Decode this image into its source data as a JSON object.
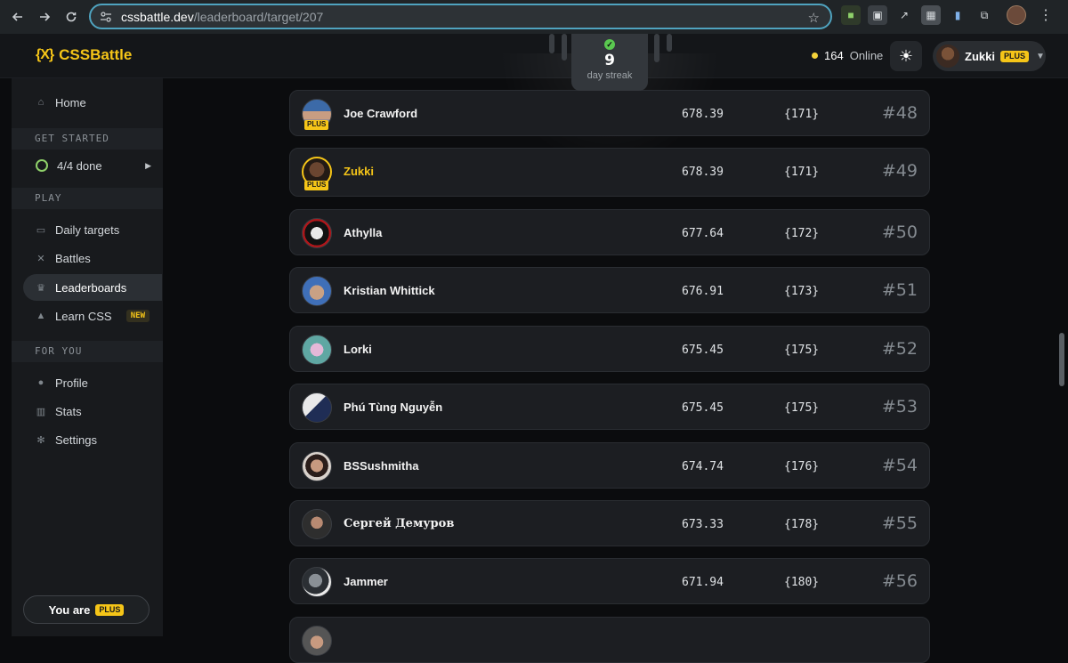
{
  "browser": {
    "url_domain": "cssbattle.dev",
    "url_path": "/leaderboard/target/207",
    "icons": [
      "back-icon",
      "forward-icon",
      "reload-icon",
      "site-info-icon",
      "bookmark-star-icon",
      "extensions-icon",
      "profile-avatar",
      "menu-icon"
    ]
  },
  "header": {
    "logo_mark": "{X}",
    "logo_text": "CSSBattle",
    "online_count": "164",
    "online_label": "Online",
    "user_name": "Zukki",
    "plus_label": "PLUS",
    "accent_color": "#f5c518"
  },
  "streak": {
    "count": "9",
    "label": "day streak"
  },
  "sidebar": {
    "home": "Home",
    "get_started_title": "GET STARTED",
    "progress": "4/4 done",
    "play_title": "PLAY",
    "daily_targets": "Daily targets",
    "battles": "Battles",
    "leaderboards": "Leaderboards",
    "learn_css": "Learn CSS",
    "new_badge": "NEW",
    "for_you_title": "FOR YOU",
    "profile": "Profile",
    "stats": "Stats",
    "settings": "Settings",
    "you_are": "You are",
    "you_are_badge": "PLUS"
  },
  "leaderboard": {
    "rows": [
      {
        "name": "Joe Crawford",
        "score": "678.39",
        "chars": "{171}",
        "rank": "#48",
        "plus": true
      },
      {
        "name": "Zukki",
        "score": "678.39",
        "chars": "{171}",
        "rank": "#49",
        "plus": true,
        "me": true
      },
      {
        "name": "Athylla",
        "score": "677.64",
        "chars": "{172}",
        "rank": "#50"
      },
      {
        "name": "Kristian Whittick",
        "score": "676.91",
        "chars": "{173}",
        "rank": "#51"
      },
      {
        "name": "Lorki",
        "score": "675.45",
        "chars": "{175}",
        "rank": "#52"
      },
      {
        "name": "Phú Tùng Nguyễn",
        "score": "675.45",
        "chars": "{175}",
        "rank": "#53"
      },
      {
        "name": "BSSushmitha",
        "score": "674.74",
        "chars": "{176}",
        "rank": "#54"
      },
      {
        "name": "Сергей Демуров",
        "score": "673.33",
        "chars": "{178}",
        "rank": "#55"
      },
      {
        "name": "Jammer",
        "score": "671.94",
        "chars": "{180}",
        "rank": "#56"
      }
    ]
  }
}
